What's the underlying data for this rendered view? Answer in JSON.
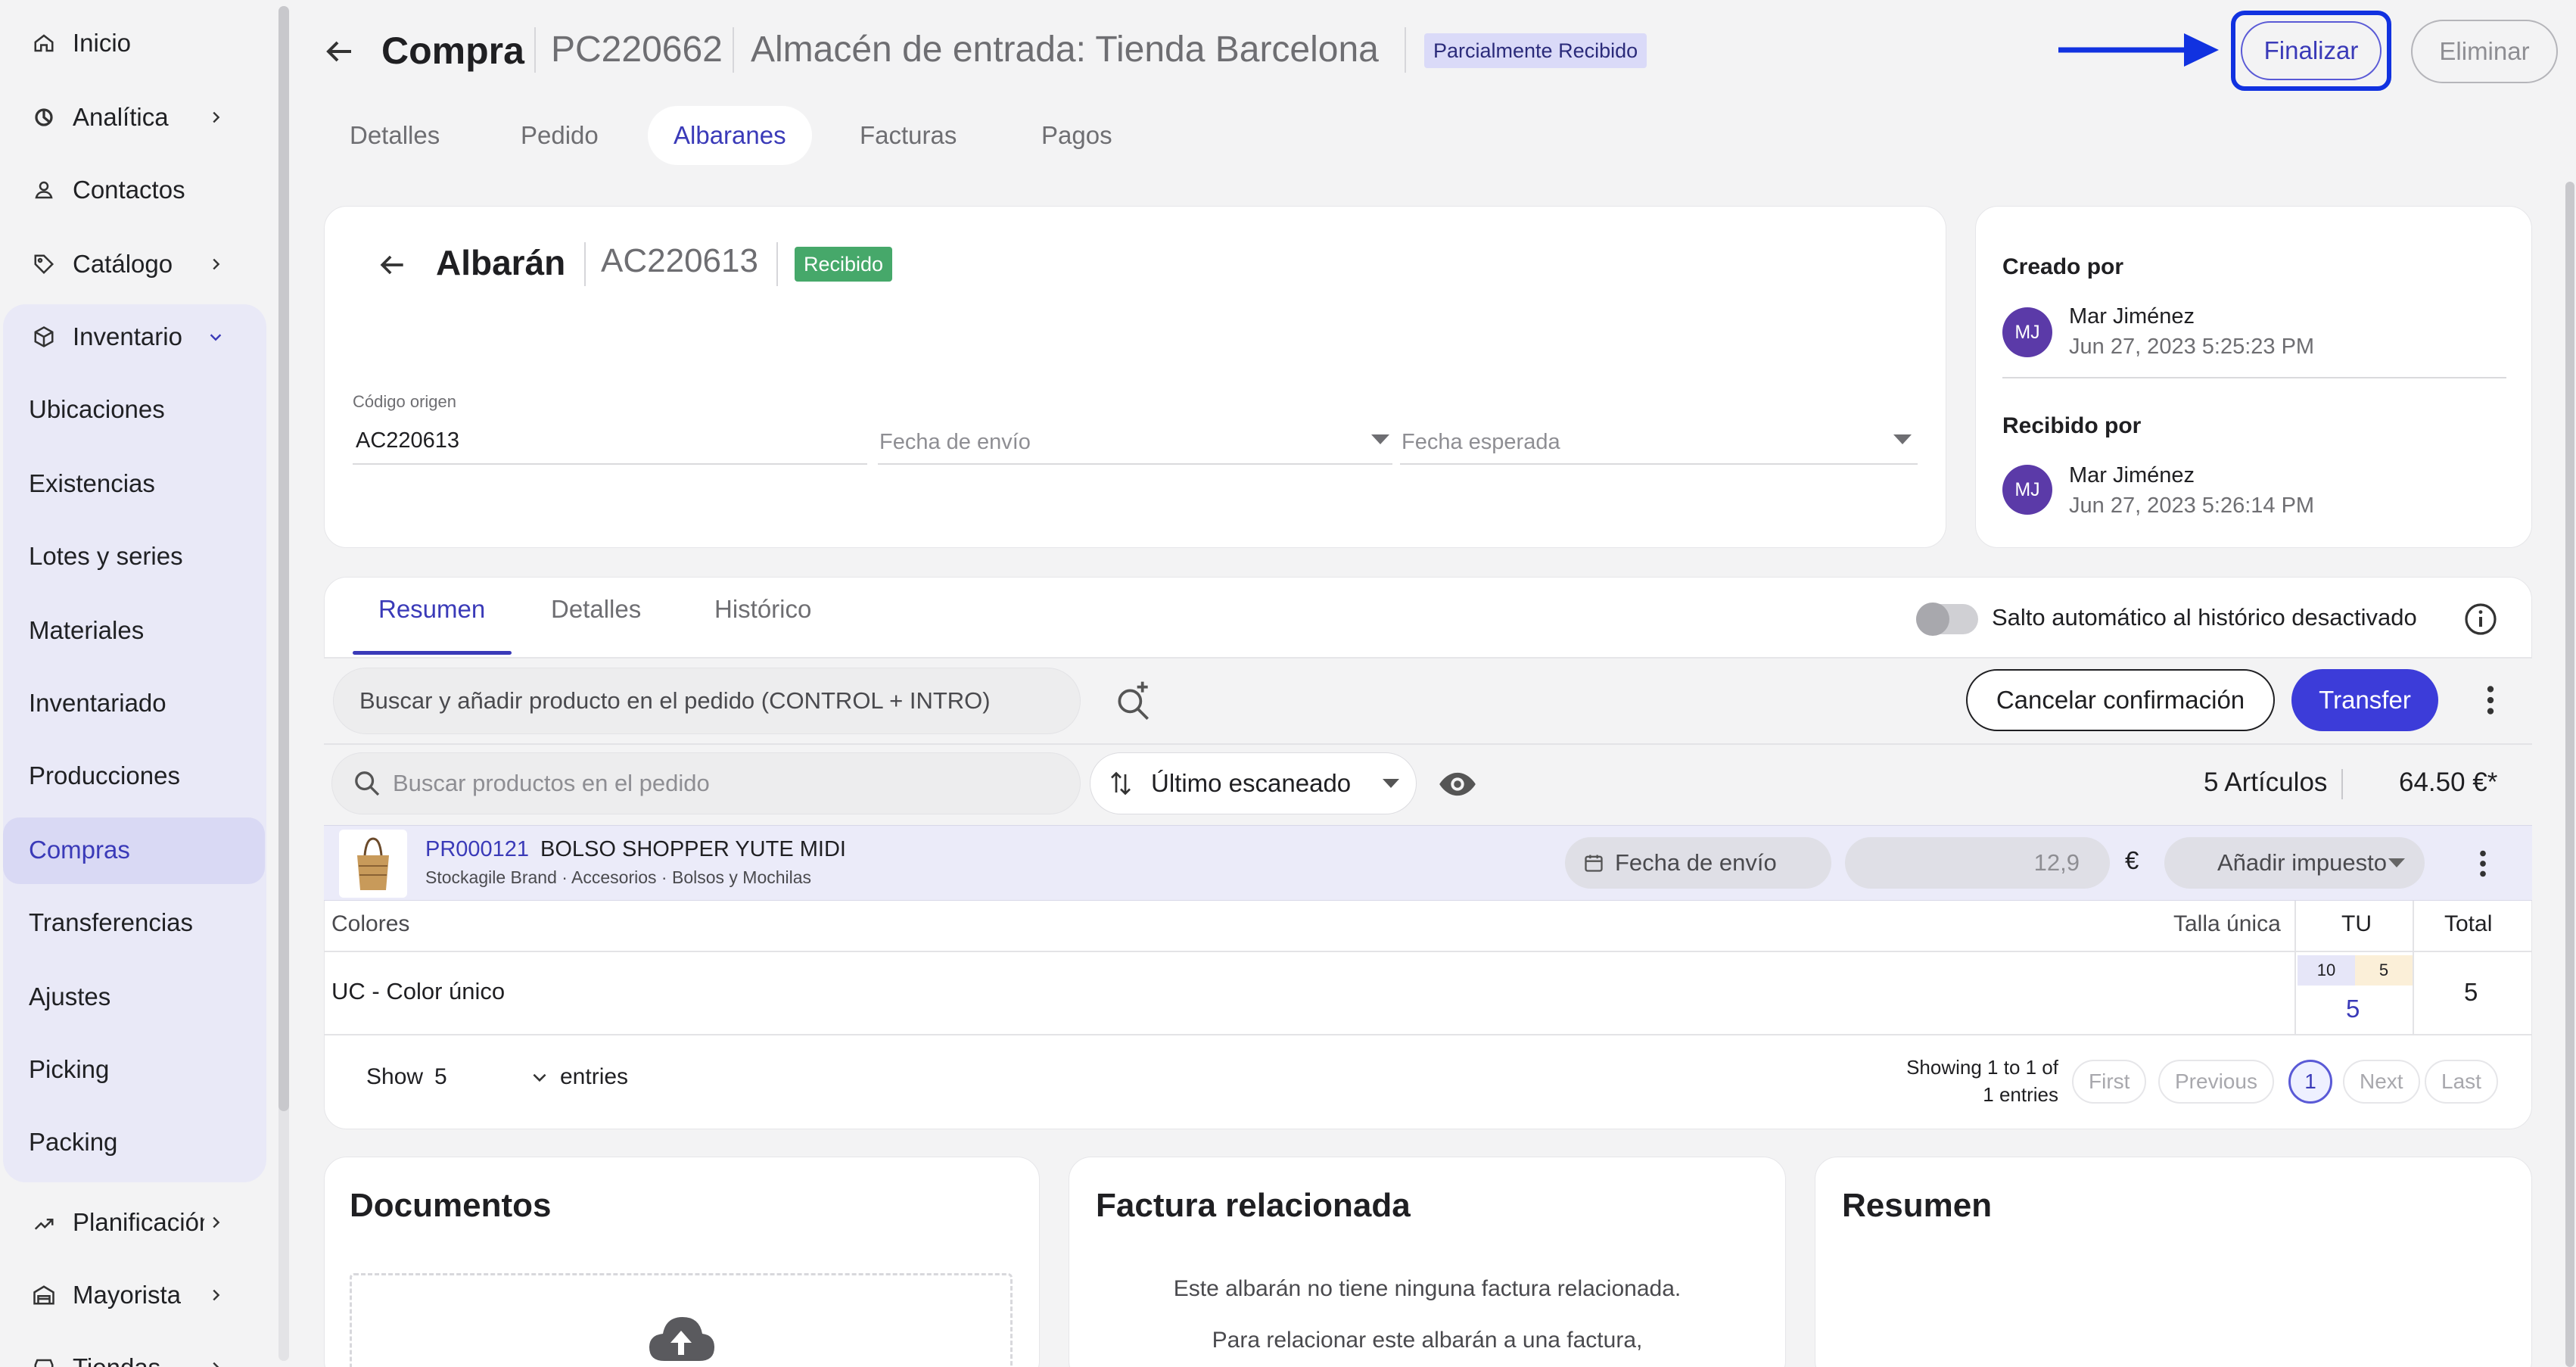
{
  "sidebar": {
    "items": [
      {
        "label": "Inicio",
        "icon": "home-icon"
      },
      {
        "label": "Analítica",
        "icon": "chart-icon"
      },
      {
        "label": "Contactos",
        "icon": "user-icon"
      },
      {
        "label": "Catálogo",
        "icon": "tag-icon"
      },
      {
        "label": "Inventario",
        "icon": "box-icon"
      },
      {
        "label": "Planificación",
        "icon": "trend-icon"
      },
      {
        "label": "Mayorista",
        "icon": "warehouse-icon"
      },
      {
        "label": "Tiendas",
        "icon": "store-icon"
      }
    ],
    "inventario_sub": [
      "Ubicaciones",
      "Existencias",
      "Lotes y series",
      "Materiales",
      "Inventariado",
      "Producciones",
      "Compras",
      "Transferencias",
      "Ajustes",
      "Picking",
      "Packing"
    ]
  },
  "header": {
    "title": "Compra",
    "code": "PC220662",
    "warehouse": "Almacén de entrada: Tienda Barcelona",
    "status": "Parcialmente Recibido",
    "finalize": "Finalizar",
    "delete": "Eliminar"
  },
  "tabs": [
    "Detalles",
    "Pedido",
    "Albaranes",
    "Facturas",
    "Pagos"
  ],
  "albaran": {
    "title": "Albarán",
    "code": "AC220613",
    "status": "Recibido",
    "origin_label": "Código origen",
    "origin_value": "AC220613",
    "ship_date_placeholder": "Fecha de envío",
    "expected_date_placeholder": "Fecha esperada"
  },
  "side_info": {
    "created_label": "Creado por",
    "created_initials": "MJ",
    "created_name": "Mar Jiménez",
    "created_date": "Jun 27, 2023 5:25:23 PM",
    "received_label": "Recibido por",
    "received_initials": "MJ",
    "received_name": "Mar Jiménez",
    "received_date": "Jun 27, 2023 5:26:14 PM"
  },
  "inner_tabs": [
    "Resumen",
    "Detalles",
    "Histórico"
  ],
  "toggle_label": "Salto automático al histórico desactivado",
  "toolbar": {
    "add_product_placeholder": "Buscar y añadir producto en el pedido (CONTROL + INTRO)",
    "cancel": "Cancelar confirmación",
    "transfer": "Transfer",
    "search_placeholder": "Buscar productos en el pedido",
    "sort_value": "Último escaneado",
    "items_count": "5 Artículos",
    "total": "64.50 €*"
  },
  "product": {
    "code": "PR000121",
    "name": "BOLSO SHOPPER YUTE MIDI",
    "meta": "Stockagile Brand · Accesorios · Bolsos y Mochilas",
    "ship_date": "Fecha de envío",
    "price": "12,9",
    "currency": "€",
    "tax": "Añadir impuesto"
  },
  "variants": {
    "col_colors": "Colores",
    "col_size": "Talla única",
    "col_tu": "TU",
    "col_total": "Total",
    "row_name": "UC - Color único",
    "stock_a": "10",
    "stock_b": "5",
    "qty": "5",
    "total": "5"
  },
  "pagination": {
    "show": "Show",
    "entries_value": "5",
    "entries": "entries",
    "showing_line1": "Showing 1 to 1 of",
    "showing_line2": "1 entries",
    "first": "First",
    "previous": "Previous",
    "page": "1",
    "next": "Next",
    "last": "Last"
  },
  "bottom": {
    "documents_title": "Documentos",
    "invoice_title": "Factura relacionada",
    "invoice_text1": "Este albarán no tiene ninguna factura relacionada.",
    "invoice_text2": "Para relacionar este albarán a una factura,",
    "summary_title": "Resumen"
  }
}
